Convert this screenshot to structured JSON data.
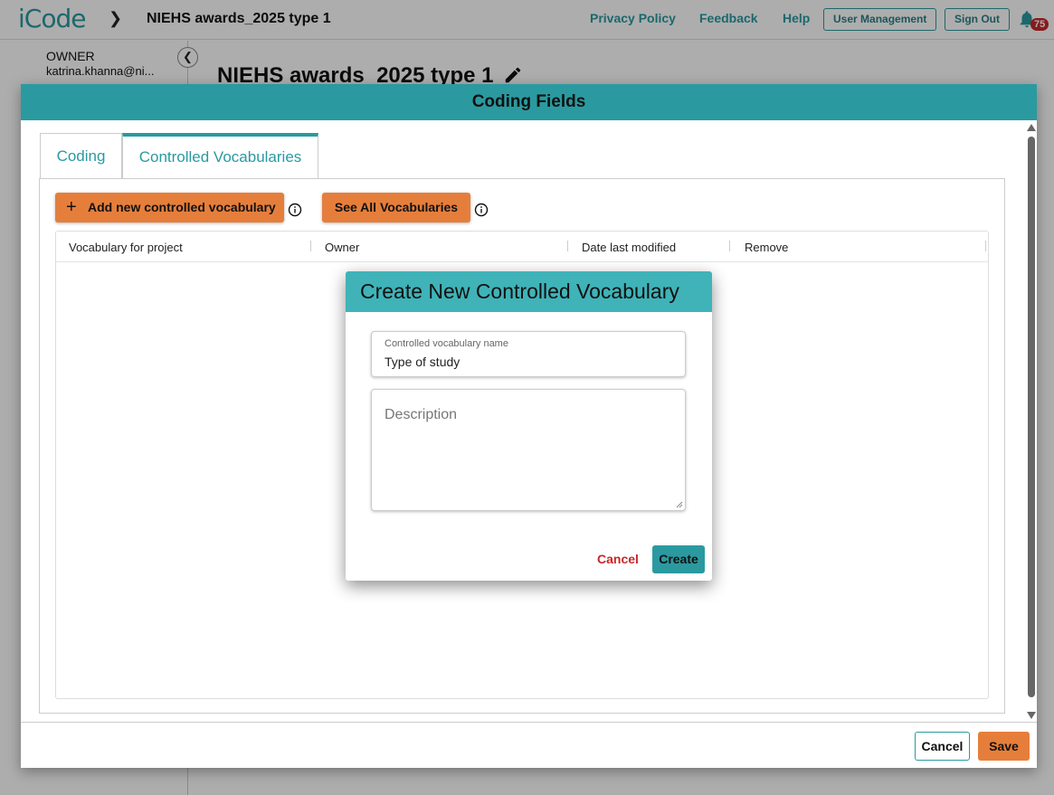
{
  "app": {
    "logo": "iCode",
    "breadcrumb_title": "NIEHS awards_2025 type 1"
  },
  "topnav": {
    "privacy": "Privacy Policy",
    "feedback": "Feedback",
    "help": "Help",
    "user_management": "User Management",
    "sign_out": "Sign Out",
    "notification_count": "75"
  },
  "sidebar": {
    "owner_label": "OWNER",
    "owner_email": "katrina.khanna@ni..."
  },
  "page": {
    "title": "NIEHS awards_2025 type 1"
  },
  "coding_fields": {
    "title": "Coding Fields",
    "tabs": [
      {
        "label": "Coding",
        "active": false
      },
      {
        "label": "Controlled Vocabularies",
        "active": true
      }
    ],
    "add_button": "Add new controlled vocabulary",
    "see_all_button": "See All Vocabularies",
    "columns": [
      "Vocabulary for project",
      "Owner",
      "Date last modified",
      "Remove"
    ],
    "rows": [],
    "footer": {
      "cancel": "Cancel",
      "save": "Save"
    }
  },
  "dialog": {
    "title": "Create New Controlled Vocabulary",
    "name_label": "Controlled vocabulary name",
    "name_value": "Type of study",
    "description_placeholder": "Description",
    "description_value": "",
    "cancel": "Cancel",
    "create": "Create"
  },
  "colors": {
    "teal": "#2a9aa0",
    "dialog_header": "#3fb3b8",
    "orange": "#e67e3b",
    "danger": "#c62828"
  },
  "icons": [
    "chevron-right-icon",
    "bell-icon",
    "chevron-left-icon",
    "pencil-icon",
    "plus-icon",
    "info-icon"
  ]
}
